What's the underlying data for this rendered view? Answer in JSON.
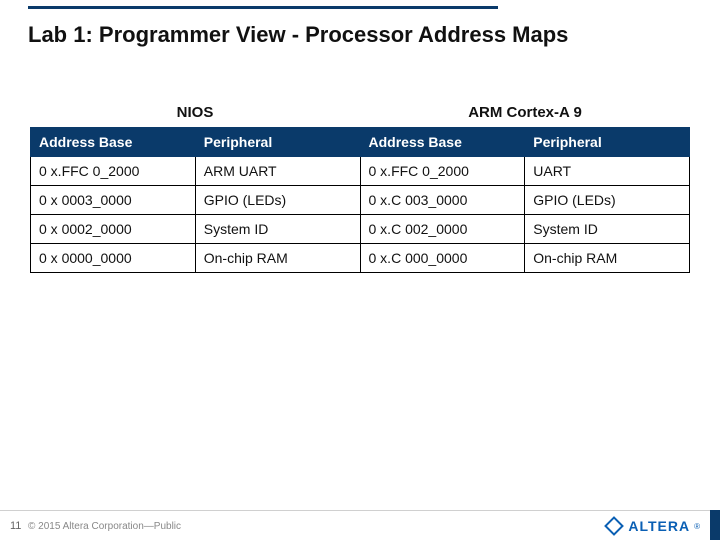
{
  "title": "Lab 1: Programmer View - Processor Address Maps",
  "columns": {
    "left": "NIOS",
    "right": "ARM Cortex-A 9"
  },
  "headers": [
    "Address Base",
    "Peripheral",
    "Address Base",
    "Peripheral"
  ],
  "rows": [
    [
      "0 x.FFC 0_2000",
      "ARM UART",
      "0 x.FFC 0_2000",
      "UART"
    ],
    [
      "0 x 0003_0000",
      "GPIO (LEDs)",
      "0 x.C 003_0000",
      "GPIO (LEDs)"
    ],
    [
      "0 x 0002_0000",
      "System ID",
      "0 x.C 002_0000",
      "System ID"
    ],
    [
      "0 x 0000_0000",
      "On-chip RAM",
      "0 x.C 000_0000",
      "On-chip RAM"
    ]
  ],
  "footer": {
    "page": "11",
    "copyright": "© 2015 Altera Corporation—Public",
    "logo": "ALTERA",
    "reg": "®"
  }
}
